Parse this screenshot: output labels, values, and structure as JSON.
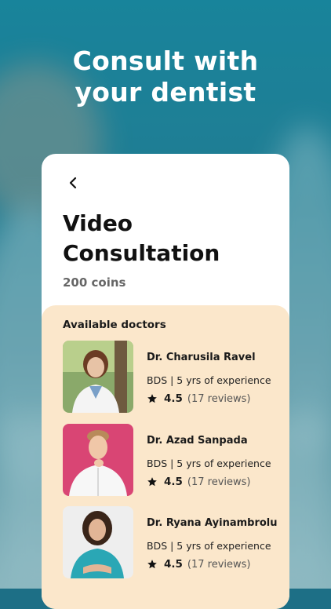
{
  "headline": {
    "line1": "Consult with",
    "line2": "your dentist"
  },
  "card": {
    "title": "Video Consultation",
    "price": "200 coins",
    "section_title": "Available doctors"
  },
  "doctors": [
    {
      "name": "Dr. Charusila Ravel",
      "meta": "BDS | 5 yrs of experience",
      "rating": "4.5",
      "reviews": "(17 reviews)"
    },
    {
      "name": "Dr. Azad Sanpada",
      "meta": "BDS | 5 yrs of experience",
      "rating": "4.5",
      "reviews": "(17 reviews)"
    },
    {
      "name": "Dr. Ryana Ayinambrolu",
      "meta": "BDS | 5 yrs of experience",
      "rating": "4.5",
      "reviews": "(17 reviews)"
    }
  ],
  "icons": {
    "back": "chevron-left-icon",
    "star": "star-icon"
  },
  "colors": {
    "background": "#1d8aa3",
    "panel": "#fbe7cb",
    "card": "#ffffff"
  }
}
